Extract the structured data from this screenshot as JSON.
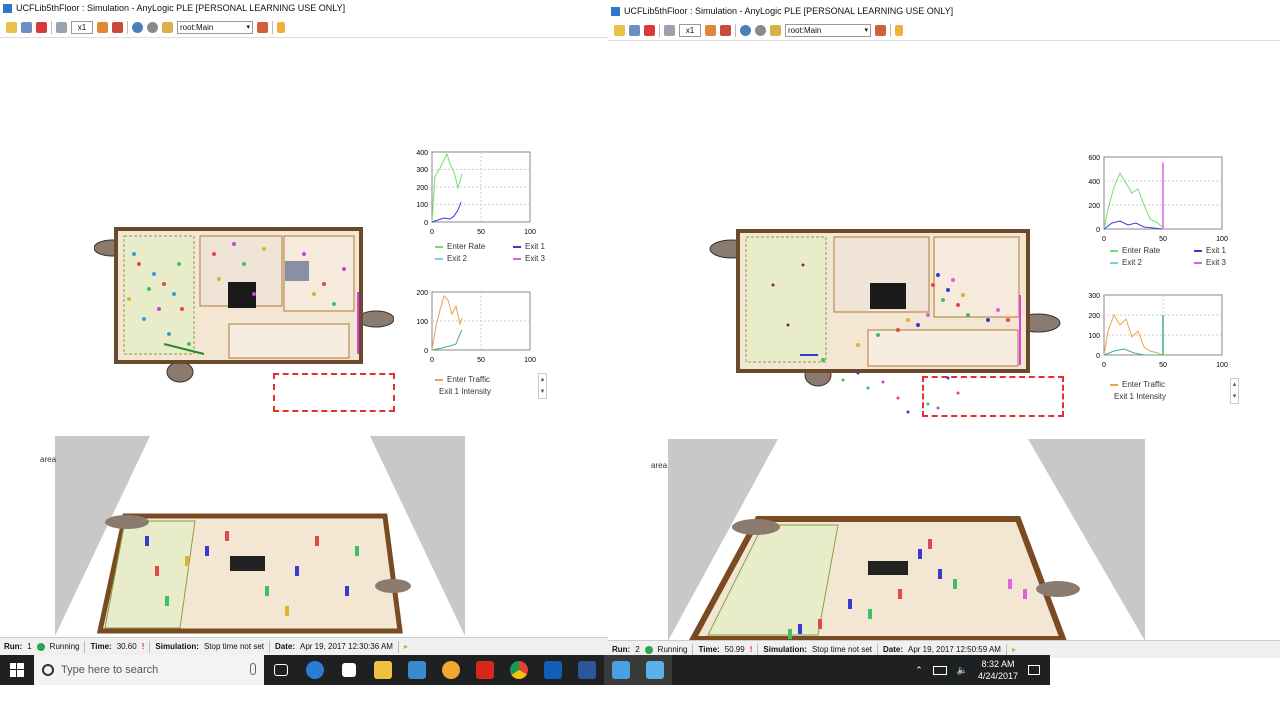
{
  "left_window": {
    "title": "UCFLib5thFloor : Simulation - AnyLogic PLE [PERSONAL LEARNING USE ONLY]",
    "toolbar": {
      "speed": "x1",
      "view_combo": "root:Main"
    },
    "chart_top": {
      "yticks": [
        "400",
        "300",
        "200",
        "100",
        "0"
      ],
      "xticks": [
        "0",
        "50",
        "100"
      ],
      "legend": [
        "Enter Rate",
        "Exit 1",
        "Exit 2",
        "Exit 3"
      ]
    },
    "chart_bottom": {
      "yticks": [
        "200",
        "100",
        "0"
      ],
      "xticks": [
        "0",
        "50",
        "100"
      ],
      "legend": [
        "Enter Traffic",
        "Exit 1 Intensity"
      ]
    },
    "area_label": "area",
    "status": {
      "run_label": "Run:",
      "run_value": "1",
      "run_state": "Running",
      "time_label": "Time:",
      "time_value": "30.60",
      "sim_label": "Simulation:",
      "sim_value": "Stop time not set",
      "date_label": "Date:",
      "date_value": "Apr 19, 2017 12:30:36 AM"
    }
  },
  "right_window": {
    "title": "UCFLib5thFloor : Simulation - AnyLogic PLE [PERSONAL LEARNING USE ONLY]",
    "toolbar": {
      "speed": "x1",
      "view_combo": "root:Main"
    },
    "chart_top": {
      "yticks": [
        "600",
        "400",
        "200",
        "0"
      ],
      "xticks": [
        "0",
        "50",
        "100"
      ],
      "legend": [
        "Enter Rate",
        "Exit 1",
        "Exit 2",
        "Exit 3"
      ]
    },
    "chart_bottom": {
      "yticks": [
        "300",
        "200",
        "100",
        "0"
      ],
      "xticks": [
        "0",
        "50",
        "100"
      ],
      "legend": [
        "Enter Traffic",
        "Exit 1 Intensity"
      ]
    },
    "area_label": "area",
    "status": {
      "run_label": "Run:",
      "run_value": "2",
      "run_state": "Running",
      "time_label": "Time:",
      "time_value": "50.99",
      "sim_label": "Simulation:",
      "sim_value": "Stop time not set",
      "date_label": "Date:",
      "date_value": "Apr 19, 2017 12:50:59 AM"
    }
  },
  "taskbar": {
    "search_placeholder": "Type here to search",
    "time": "8:32 AM",
    "date": "4/24/2017"
  },
  "colors": {
    "enter_rate": "#6ee06e",
    "exit1": "#3a3ad0",
    "exit2": "#70d8e0",
    "exit3": "#e060e0",
    "enter_traffic": "#f0a050",
    "exit1_intensity": "#40b080"
  }
}
